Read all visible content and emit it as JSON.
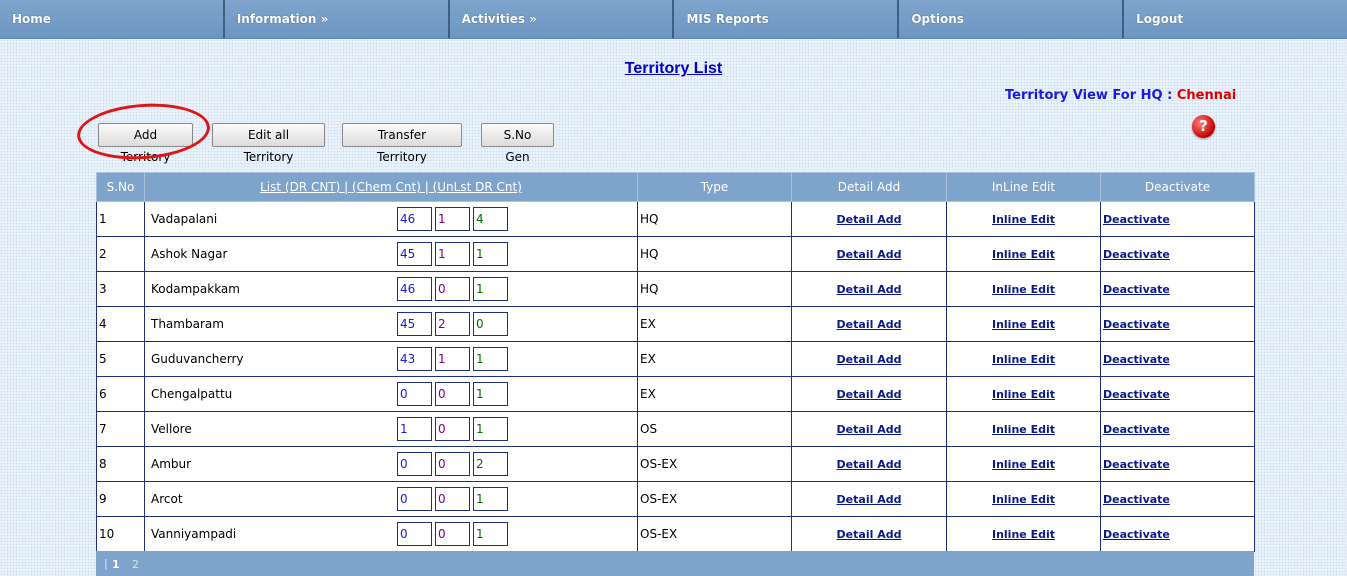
{
  "nav": [
    "Home",
    "Information »",
    "Activities »",
    "MIS Reports",
    "Options",
    "Logout"
  ],
  "page_title": "Territory List",
  "hq": {
    "label": "Territory View For HQ :",
    "city": "Chennai"
  },
  "help_glyph": "?",
  "buttons": {
    "add": "Add Territory",
    "edit_all": "Edit all Territory",
    "transfer": "Transfer Territory",
    "sno_gen": "S.No Gen"
  },
  "table": {
    "headers": {
      "sno": "S.No",
      "list": "List (DR CNT) | (Chem Cnt) | (UnLst DR Cnt)",
      "type": "Type",
      "detail": "Detail Add",
      "inline": "InLine Edit",
      "deactivate": "Deactivate"
    },
    "link_labels": {
      "detail": "Detail Add",
      "inline": "Inline Edit",
      "deactivate": "Deactivate"
    },
    "rows": [
      {
        "sno": "1",
        "name": "Vadapalani",
        "dr": "46",
        "chem": "1",
        "unlst": "4",
        "type": "HQ"
      },
      {
        "sno": "2",
        "name": "Ashok Nagar",
        "dr": "45",
        "chem": "1",
        "unlst": "1",
        "type": "HQ"
      },
      {
        "sno": "3",
        "name": "Kodampakkam",
        "dr": "46",
        "chem": "0",
        "unlst": "1",
        "type": "HQ"
      },
      {
        "sno": "4",
        "name": "Thambaram",
        "dr": "45",
        "chem": "2",
        "unlst": "0",
        "type": "EX"
      },
      {
        "sno": "5",
        "name": "Guduvancherry",
        "dr": "43",
        "chem": "1",
        "unlst": "1",
        "type": "EX"
      },
      {
        "sno": "6",
        "name": "Chengalpattu",
        "dr": "0",
        "chem": "0",
        "unlst": "1",
        "type": "EX"
      },
      {
        "sno": "7",
        "name": "Vellore",
        "dr": "1",
        "chem": "0",
        "unlst": "1",
        "type": "OS"
      },
      {
        "sno": "8",
        "name": "Ambur",
        "dr": "0",
        "chem": "0",
        "unlst": "2",
        "type": "OS-EX"
      },
      {
        "sno": "9",
        "name": "Arcot",
        "dr": "0",
        "chem": "0",
        "unlst": "1",
        "type": "OS-EX"
      },
      {
        "sno": "10",
        "name": "Vanniyampadi",
        "dr": "0",
        "chem": "0",
        "unlst": "1",
        "type": "OS-EX"
      }
    ]
  },
  "pager": {
    "separator": "|",
    "pages": [
      "1",
      "2"
    ],
    "current": "1"
  },
  "colors": {
    "nav": "#7ea4cc",
    "title_link": "#0000c8",
    "hq_city": "#e00000",
    "highlight_circle": "#e01515"
  }
}
